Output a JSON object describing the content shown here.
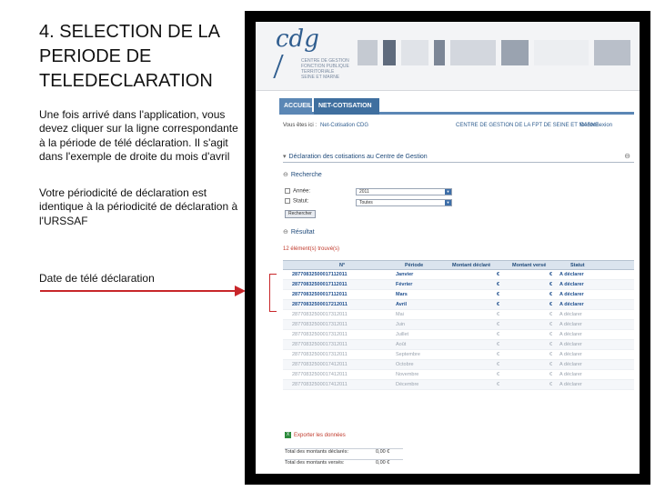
{
  "slide": {
    "title": "4. SELECTION DE LA PERIODE DE TELEDECLARATION",
    "paragraph1": "Une fois arrivé dans l'application, vous devez cliquer sur la ligne correspondante à la période de télé déclaration. Il s'agit dans l'exemple de droite du mois d'avril",
    "paragraph2": "Votre périodicité de déclaration est identique à la périodicité de déclaration à l'URSSAF",
    "callout": "Date de télé déclaration",
    "accent_color": "#c8262a"
  },
  "app": {
    "logo": {
      "mark": "cdg",
      "line1": "CENTRE DE GESTION",
      "line2": "FONCTION PUBLIQUE TERRITORIALE",
      "line3": "SEINE ET MARNE"
    },
    "nav": {
      "tab_home": "ACCUEIL",
      "tab_active": "NET-COTISATION CDG"
    },
    "breadcrumb": {
      "label": "Vous êtes ici :",
      "value": "Net-Cotisation CDG"
    },
    "org_link": "CENTRE DE GESTION DE LA FPT DE SEINE ET MARNE",
    "logout_link": "Déconnexion",
    "section_main": "Déclaration des cotisations au Centre de Gestion",
    "section_search": "Recherche",
    "filters": {
      "year_label": "Année:",
      "year_value": "2011",
      "status_label": "Statut:",
      "status_value": "Toutes",
      "search_button": "Rechercher"
    },
    "section_result": "Résultat",
    "result_count": "12 élément(s) trouvé(s)",
    "table": {
      "headers": [
        "N°",
        "Période",
        "Montant déclaré",
        "Montant versé",
        "Statut"
      ],
      "rows": [
        {
          "num": "28770832500017112011",
          "period": "Janvier",
          "declared": "€",
          "paid": "€",
          "status": "A déclarer",
          "state": "active"
        },
        {
          "num": "28770832500017112011",
          "period": "Février",
          "declared": "€",
          "paid": "€",
          "status": "A déclarer",
          "state": "active"
        },
        {
          "num": "28770832500017112011",
          "period": "Mars",
          "declared": "€",
          "paid": "€",
          "status": "A déclarer",
          "state": "active"
        },
        {
          "num": "28770832500017212011",
          "period": "Avril",
          "declared": "€",
          "paid": "€",
          "status": "A déclarer",
          "state": "active"
        },
        {
          "num": "28770832500017312011",
          "period": "Mai",
          "declared": "€",
          "paid": "€",
          "status": "A déclarer",
          "state": "dim"
        },
        {
          "num": "28770832500017312011",
          "period": "Juin",
          "declared": "€",
          "paid": "€",
          "status": "A déclarer",
          "state": "dim"
        },
        {
          "num": "28770832500017312011",
          "period": "Juillet",
          "declared": "€",
          "paid": "€",
          "status": "A déclarer",
          "state": "dim"
        },
        {
          "num": "28770832500017312011",
          "period": "Août",
          "declared": "€",
          "paid": "€",
          "status": "A déclarer",
          "state": "dim"
        },
        {
          "num": "28770832500017312011",
          "period": "Septembre",
          "declared": "€",
          "paid": "€",
          "status": "A déclarer",
          "state": "dim"
        },
        {
          "num": "28770832500017412011",
          "period": "Octobre",
          "declared": "€",
          "paid": "€",
          "status": "A déclarer",
          "state": "dim"
        },
        {
          "num": "28770832500017412011",
          "period": "Novembre",
          "declared": "€",
          "paid": "€",
          "status": "A déclarer",
          "state": "dim"
        },
        {
          "num": "28770832500017412011",
          "period": "Décembre",
          "declared": "€",
          "paid": "€",
          "status": "A déclarer",
          "state": "dim"
        }
      ]
    },
    "export_label": "Exporter les données",
    "totals": {
      "declared_label": "Total des montants déclarés:",
      "declared_value": "0,00 €",
      "paid_label": "Total des montants versés:",
      "paid_value": "0,00 €"
    }
  }
}
